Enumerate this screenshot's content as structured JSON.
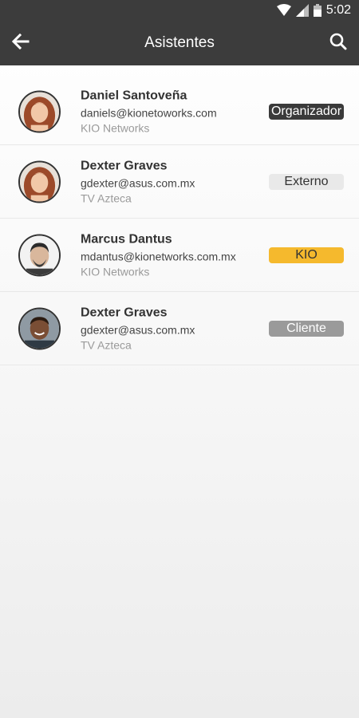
{
  "status_bar": {
    "time": "5:02",
    "icons": [
      "wifi-icon",
      "signal-icon",
      "battery-icon"
    ]
  },
  "app_bar": {
    "title": "Asistentes",
    "back_icon": "arrow-left-icon",
    "search_icon": "search-icon"
  },
  "attendees": [
    {
      "name": "Daniel Santoveña",
      "email": "daniels@kionetoworks.com",
      "company": "KIO Networks",
      "role": "Organizador",
      "avatar": "woman-red-hair"
    },
    {
      "name": "Dexter Graves",
      "email": "gdexter@asus.com.mx",
      "company": "TV Azteca",
      "role": "Externo",
      "avatar": "woman-red-hair"
    },
    {
      "name": "Marcus Dantus",
      "email": "mdantus@kionetworks.com.mx",
      "company": "KIO Networks",
      "role": "KIO",
      "avatar": "man-dark-hair"
    },
    {
      "name": "Dexter Graves",
      "email": "gdexter@asus.com.mx",
      "company": "TV Azteca",
      "role": "Cliente",
      "avatar": "man-smiling"
    }
  ],
  "colors": {
    "app_bar": "#3c3c3c",
    "kio_badge": "#f5b92d",
    "organizer_badge": "#3a3a3a",
    "client_badge": "#9a9a9a",
    "external_badge": "#e9e9e9"
  }
}
